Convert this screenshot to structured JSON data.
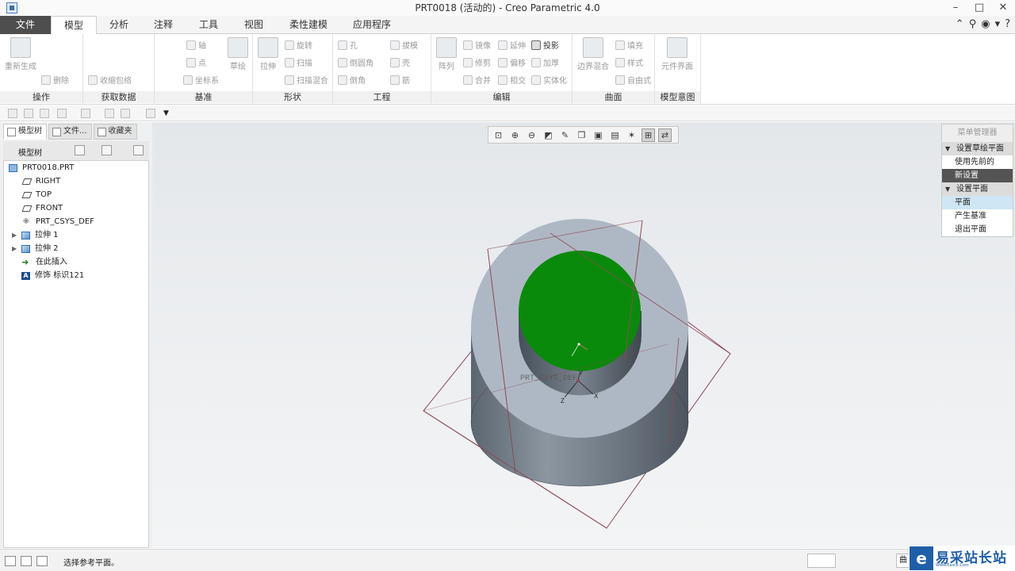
{
  "window": {
    "title": "PRT0018 (活动的) - Creo Parametric 4.0",
    "controls": [
      "–",
      "□",
      "✕"
    ]
  },
  "ribbon": {
    "tabs": [
      "文件",
      "模型",
      "分析",
      "注释",
      "工具",
      "视图",
      "柔性建模",
      "应用程序"
    ],
    "groups": {
      "operations": {
        "label": "操作",
        "regenerate": "重新生成",
        "delete": "删除"
      },
      "get_data": {
        "label": "获取数据",
        "shrinkwrap": "收缩包络"
      },
      "datum": {
        "label": "基准",
        "axis": "轴",
        "point": "点",
        "csys": "坐标系",
        "sketch": "草绘"
      },
      "shapes": {
        "label": "形状",
        "extrude": "拉伸",
        "revolve": "旋转",
        "sweep": "扫描",
        "swept_blend": "扫描混合"
      },
      "engineering": {
        "label": "工程",
        "hole": "孔",
        "round": "倒圆角",
        "chamfer": "倒角",
        "draft": "拔模",
        "shell": "壳",
        "rib": "筋"
      },
      "editing": {
        "label": "编辑",
        "pattern": "阵列",
        "mirror": "镜像",
        "trim": "修剪",
        "merge": "合并",
        "extend": "延伸",
        "offset": "偏移",
        "intersect": "相交",
        "project": "投影",
        "thicken": "加厚",
        "solidify": "实体化"
      },
      "surfaces": {
        "label": "曲面",
        "boundary_blend": "边界混合",
        "fill": "填充",
        "style": "样式",
        "freestyle": "自由式"
      },
      "model_intent": {
        "label": "模型意图",
        "component_interface": "元件界面"
      }
    }
  },
  "left_panel": {
    "tabs": [
      "模型树",
      "文件...",
      "收藏夹"
    ],
    "tree_title": "模型树",
    "tree": [
      {
        "label": "PRT0018.PRT",
        "icon": "part-icon"
      },
      {
        "label": "RIGHT",
        "icon": "datum-plane-icon"
      },
      {
        "label": "TOP",
        "icon": "datum-plane-icon"
      },
      {
        "label": "FRONT",
        "icon": "datum-plane-icon"
      },
      {
        "label": "PRT_CSYS_DEF",
        "icon": "csys-icon"
      },
      {
        "label": "拉伸 1",
        "icon": "extrude-icon",
        "expandable": true
      },
      {
        "label": "拉伸 2",
        "icon": "extrude-icon",
        "expandable": true
      },
      {
        "label": "在此插入",
        "icon": "insert-here-icon"
      },
      {
        "label": "修饰 标识121",
        "icon": "annotation-icon"
      }
    ]
  },
  "viewport": {
    "csys_label": "PRT_CSYS_DEF",
    "axis_labels": {
      "x": "X",
      "y": "Y",
      "z": "Z"
    },
    "colors": {
      "cylinder": "#6f7a85",
      "cylinder_top": "#aeb8c4",
      "selected_face": "#0a8a0a",
      "datum_edge": "#8a4a55"
    }
  },
  "menu_manager": {
    "title": "菜单管理器",
    "section1": "设置草绘平面",
    "item_use_previous": "使用先前的",
    "item_new_setting": "新设置",
    "section2": "设置平面",
    "item_plane": "平面",
    "item_make_datum": "产生基准",
    "item_quit_plane": "退出平面"
  },
  "status": {
    "message": "选择参考平面。",
    "filter": "曲"
  },
  "watermark": {
    "logo": "e",
    "text": "易采站长站",
    "sub": "Www.Easck.Com"
  }
}
